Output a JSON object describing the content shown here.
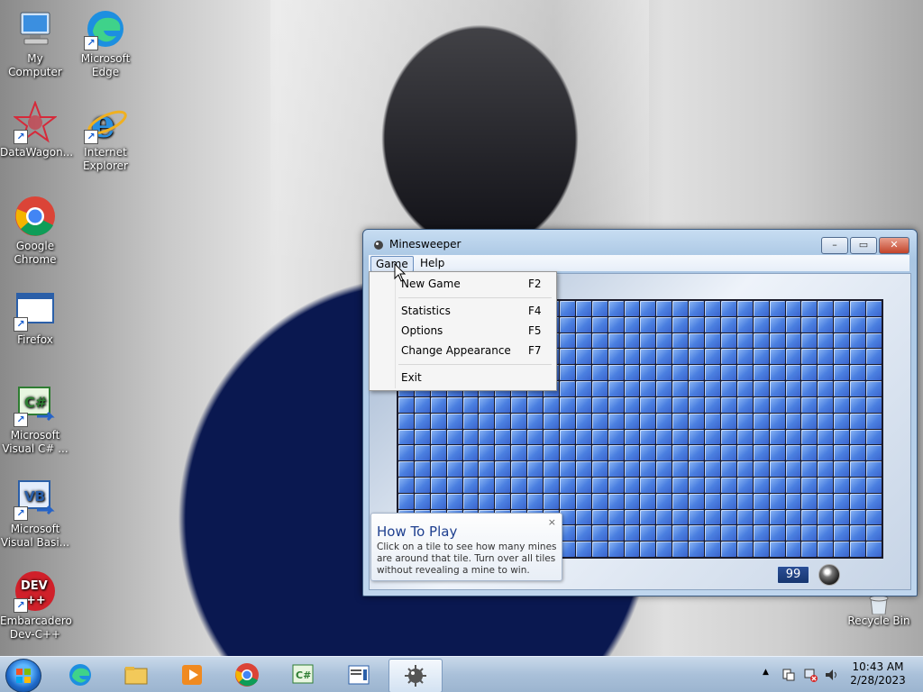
{
  "desktop": {
    "icons": [
      {
        "label": "My Computer"
      },
      {
        "label": "Microsoft Edge"
      },
      {
        "label": "DataWagon..."
      },
      {
        "label": "Internet Explorer"
      },
      {
        "label": "Google Chrome"
      },
      {
        "label": "Firefox"
      },
      {
        "label": "Microsoft Visual C# ..."
      },
      {
        "label": "Microsoft Visual Basi..."
      },
      {
        "label": "Embarcadero Dev-C++"
      }
    ],
    "recycle_bin": "Recycle Bin"
  },
  "window": {
    "title": "Minesweeper",
    "menu": {
      "game": "Game",
      "help": "Help"
    },
    "mine_count": "99"
  },
  "game_menu": {
    "items": [
      {
        "label": "New Game",
        "key": "F2"
      },
      {
        "label": "Statistics",
        "key": "F4"
      },
      {
        "label": "Options",
        "key": "F5"
      },
      {
        "label": "Change Appearance",
        "key": "F7"
      },
      {
        "label": "Exit",
        "key": ""
      }
    ]
  },
  "howto": {
    "title": "How To Play",
    "text": "Click on a tile to see how many mines are around that tile. Turn over all tiles without revealing a mine to win.",
    "close": "×"
  },
  "window_buttons": {
    "minimize": "–",
    "maximize": "▭",
    "close": "✕"
  },
  "taskbar": {
    "clock_time": "10:43 AM",
    "clock_date": "2/28/2023",
    "tray_arrow": "▲"
  }
}
